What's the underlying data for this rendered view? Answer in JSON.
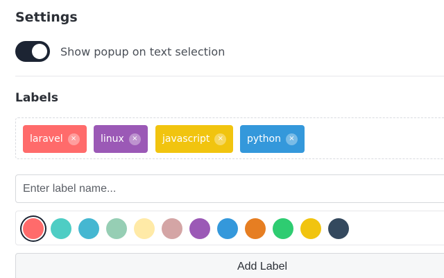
{
  "settings": {
    "title": "Settings",
    "popup_toggle": {
      "label": "Show popup on text selection",
      "enabled": true
    }
  },
  "labels": {
    "title": "Labels",
    "tags": [
      {
        "name": "laravel",
        "color": "#ff6b6b",
        "remove_glyph": "×"
      },
      {
        "name": "linux",
        "color": "#9b59b6",
        "remove_glyph": "×"
      },
      {
        "name": "javascript",
        "color": "#f1c40f",
        "remove_glyph": "×"
      },
      {
        "name": "python",
        "color": "#3498db",
        "remove_glyph": "×"
      }
    ],
    "input": {
      "placeholder": "Enter label name...",
      "value": ""
    },
    "colors": [
      {
        "hex": "#ff6b6b",
        "selected": true
      },
      {
        "hex": "#4ecdc4",
        "selected": false
      },
      {
        "hex": "#45b7d1",
        "selected": false
      },
      {
        "hex": "#96ceb4",
        "selected": false
      },
      {
        "hex": "#ffeaa7",
        "selected": false
      },
      {
        "hex": "#d4a5a5",
        "selected": false
      },
      {
        "hex": "#9b59b6",
        "selected": false
      },
      {
        "hex": "#3498db",
        "selected": false
      },
      {
        "hex": "#e67e22",
        "selected": false
      },
      {
        "hex": "#2ecc71",
        "selected": false
      },
      {
        "hex": "#f1c40f",
        "selected": false
      },
      {
        "hex": "#34495e",
        "selected": false
      }
    ],
    "add_button_label": "Add Label"
  },
  "theme": {
    "toggle_on": "#1c2433",
    "text": "#2b2f36"
  }
}
